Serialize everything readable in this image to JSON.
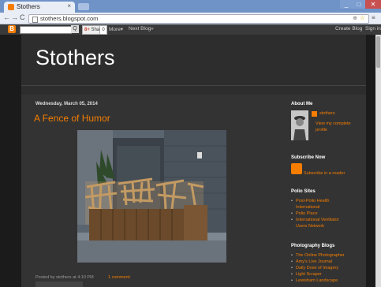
{
  "browser": {
    "tab_title": "Stothers",
    "url": "stothers.blogspot.com",
    "tab_close": "×",
    "back": "←",
    "forward": "→",
    "reload": "C",
    "win_min": "_",
    "win_max": "□",
    "win_close": "✕"
  },
  "navbar": {
    "logo": "B",
    "search_btn": "Q",
    "share_label": "Share",
    "share_prefix": "8+",
    "share_count": "0",
    "more_label": "More▾",
    "next_blog": "Next Blog»",
    "create_blog": "Create Blog",
    "sign_in": "Sign in"
  },
  "blog": {
    "title": "Stothers"
  },
  "post": {
    "date": "Wednesday, March 05, 2014",
    "title": "A Fence of Humor",
    "footer_posted": "Posted by stothers at 4:10 PM",
    "comment": "1 comment:"
  },
  "sidebar": {
    "about_title": "About Me",
    "profile_name": "stothers",
    "profile_link": "View my complete profile",
    "subscribe_title": "Subscribe Now",
    "subscribe_link": "Subscribe in a reader",
    "polio_title": "Polio Sites",
    "polio_links": [
      "Post-Polio Health International",
      "Polio Place",
      "International Ventilator Users Network"
    ],
    "photo_title": "Photography Blogs",
    "photo_links": [
      "The Online Photographer",
      "Amy's Live Journal",
      "Daily Dose of Imagery",
      "Light Scraper",
      "Lewisham Landscape"
    ]
  },
  "colors": {
    "accent": "#f57d00",
    "page_bg": "#333333",
    "outer_bg": "#1b1b1b"
  }
}
